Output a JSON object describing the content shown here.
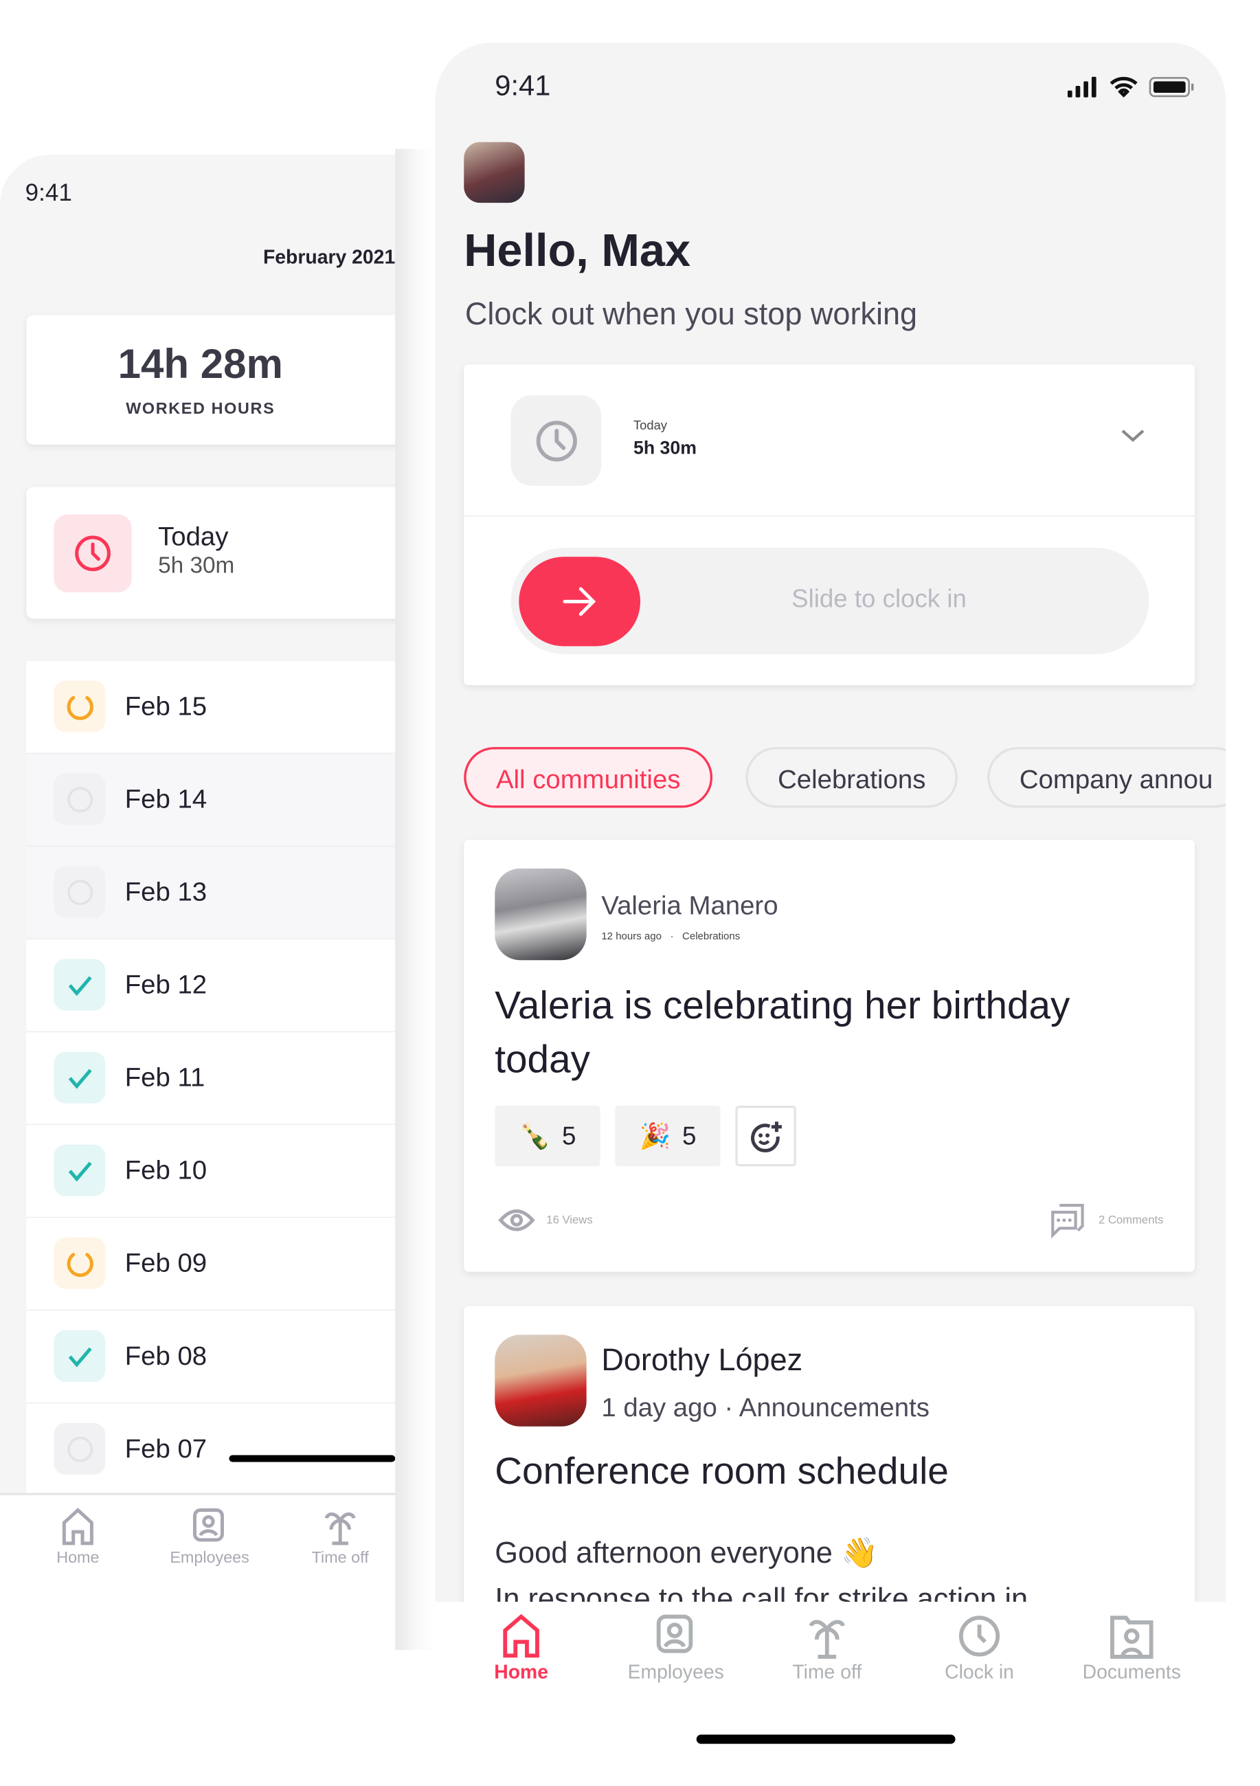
{
  "colors": {
    "accent": "#fa3657",
    "check": "#1fb5ad",
    "pending": "#f5a623"
  },
  "back_screen": {
    "status_time": "9:41",
    "month": "February 2021",
    "worked": {
      "value": "14h 28m",
      "label": "WORKED HOURS"
    },
    "today": {
      "label": "Today",
      "value": "5h 30m",
      "icon": "clock-icon"
    },
    "days": [
      {
        "date": "Feb 15",
        "status": "pending"
      },
      {
        "date": "Feb 14",
        "status": "empty"
      },
      {
        "date": "Feb 13",
        "status": "empty"
      },
      {
        "date": "Feb 12",
        "status": "done"
      },
      {
        "date": "Feb 11",
        "status": "done"
      },
      {
        "date": "Feb 10",
        "status": "done"
      },
      {
        "date": "Feb 09",
        "status": "pending"
      },
      {
        "date": "Feb 08",
        "status": "done"
      },
      {
        "date": "Feb 07",
        "status": "empty"
      }
    ],
    "nav": [
      {
        "label": "Home",
        "icon": "home-icon"
      },
      {
        "label": "Employees",
        "icon": "employees-icon"
      },
      {
        "label": "Time off",
        "icon": "palm-tree-icon"
      }
    ]
  },
  "front_screen": {
    "status_time": "9:41",
    "greeting": "Hello, Max",
    "subtitle": "Clock out when you stop working",
    "clock_card": {
      "label": "Today",
      "value": "5h 30m",
      "slider_text": "Slide to clock in"
    },
    "chips": [
      {
        "label": "All communities",
        "active": true
      },
      {
        "label": "Celebrations",
        "active": false
      },
      {
        "label": "Company annou",
        "active": false
      }
    ],
    "posts": [
      {
        "author": "Valeria Manero",
        "time": "12 hours ago",
        "sep": "·",
        "community": "Celebrations",
        "title": "Valeria is celebrating her birthday today",
        "reactions": [
          {
            "emoji": "🍾",
            "count": "5"
          },
          {
            "emoji": "🎉",
            "count": "5"
          }
        ],
        "views": "16 Views",
        "comments": "2 Comments"
      },
      {
        "author": "Dorothy López",
        "time": "1 day ago",
        "sep": "·",
        "community": "Announcements",
        "title": "Conference room schedule",
        "body1": "Good afternoon everyone 👋",
        "body2": "In response to the call for strike action in"
      }
    ],
    "nav": [
      {
        "label": "Home",
        "icon": "home-icon",
        "active": true
      },
      {
        "label": "Employees",
        "icon": "employees-icon"
      },
      {
        "label": "Time off",
        "icon": "palm-tree-icon"
      },
      {
        "label": "Clock in",
        "icon": "clock-icon"
      },
      {
        "label": "Documents",
        "icon": "documents-icon"
      }
    ]
  }
}
